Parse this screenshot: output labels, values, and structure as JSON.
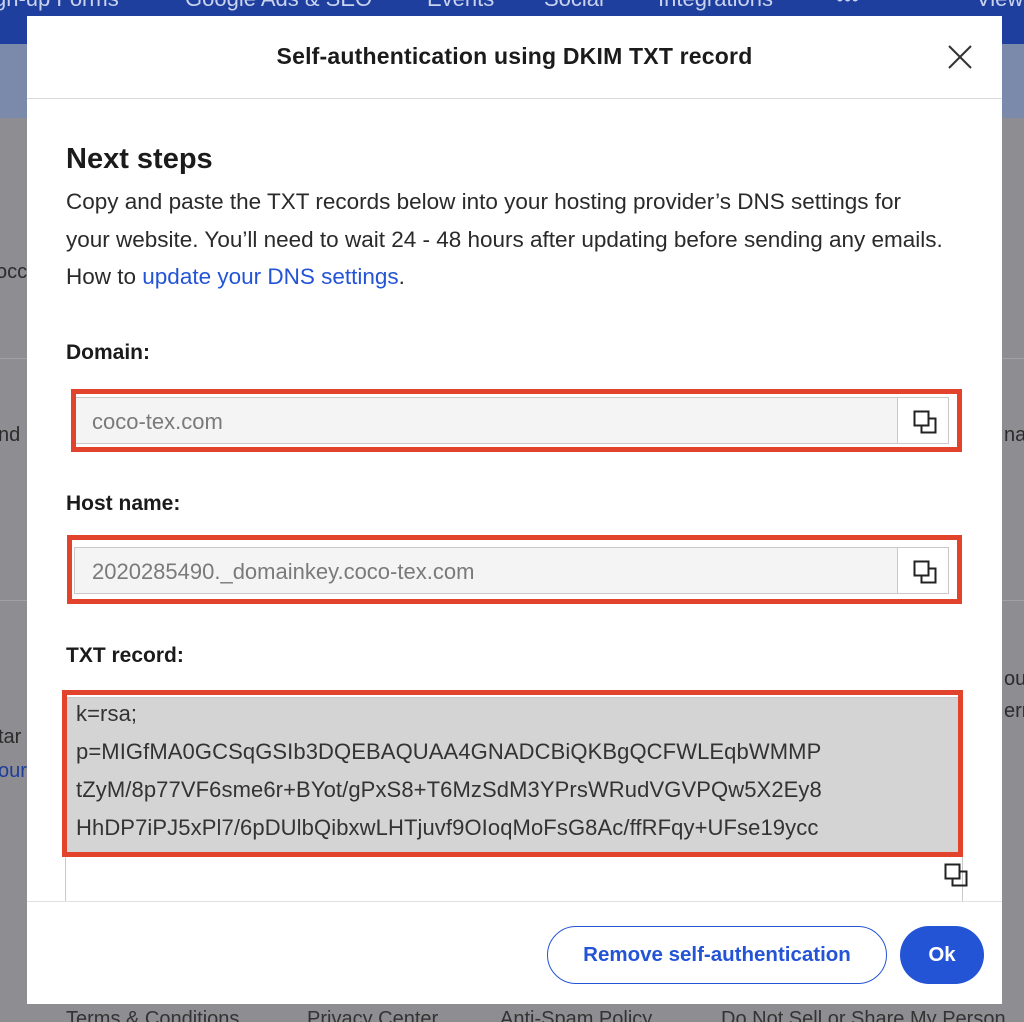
{
  "background": {
    "nav_items": [
      "gn-up Forms",
      "Google Ads & SEO",
      "Events",
      "Social",
      "Integrations",
      "•••",
      "View"
    ],
    "fragments": {
      "left_1": "occ",
      "left_2": "nd",
      "left_3": "tar",
      "left_link": "our",
      "right_1": "nat",
      "right_2": "ou",
      "right_3": "err"
    },
    "footer_links": [
      "Terms & Conditions",
      "Privacy Center",
      "Anti-Spam Policy",
      "Do Not Sell or Share My Person"
    ]
  },
  "modal": {
    "title": "Self-authentication using DKIM TXT record",
    "section_title": "Next steps",
    "description_text": "Copy and paste the TXT records below into your hosting provider’s DNS settings for your website. You’ll need to wait 24 - 48 hours after updating before sending any emails. How to ",
    "description_link": "update your DNS settings",
    "description_end": ".",
    "domain_label": "Domain:",
    "domain_value": "coco-tex.com",
    "host_label": "Host name:",
    "host_value": "2020285490._domainkey.coco-tex.com",
    "txt_label": "TXT record:",
    "txt_lines": [
      "k=rsa;",
      "p=MIGfMA0GCSqGSIb3DQEBAQUAA4GNADCBiQKBgQCFWLEqbWMMP",
      "tZyM/8p77VF6sme6r+BYot/gPxS8+T6MzSdM3YPrsWRudVGVPQw5X2Ey8",
      "HhDP7iPJ5xPl7/6pDUlbQibxwLHTjuvf9OIoqMoFsG8Ac/ffRFqy+UFse19ycc"
    ],
    "remove_label": "Remove self-authentication",
    "ok_label": "Ok"
  },
  "colors": {
    "accent": "#2454d6",
    "highlight": "#e2432d",
    "nav": "#1e3f9e"
  },
  "icons": {
    "close": "close-icon",
    "copy": "copy-icon"
  }
}
